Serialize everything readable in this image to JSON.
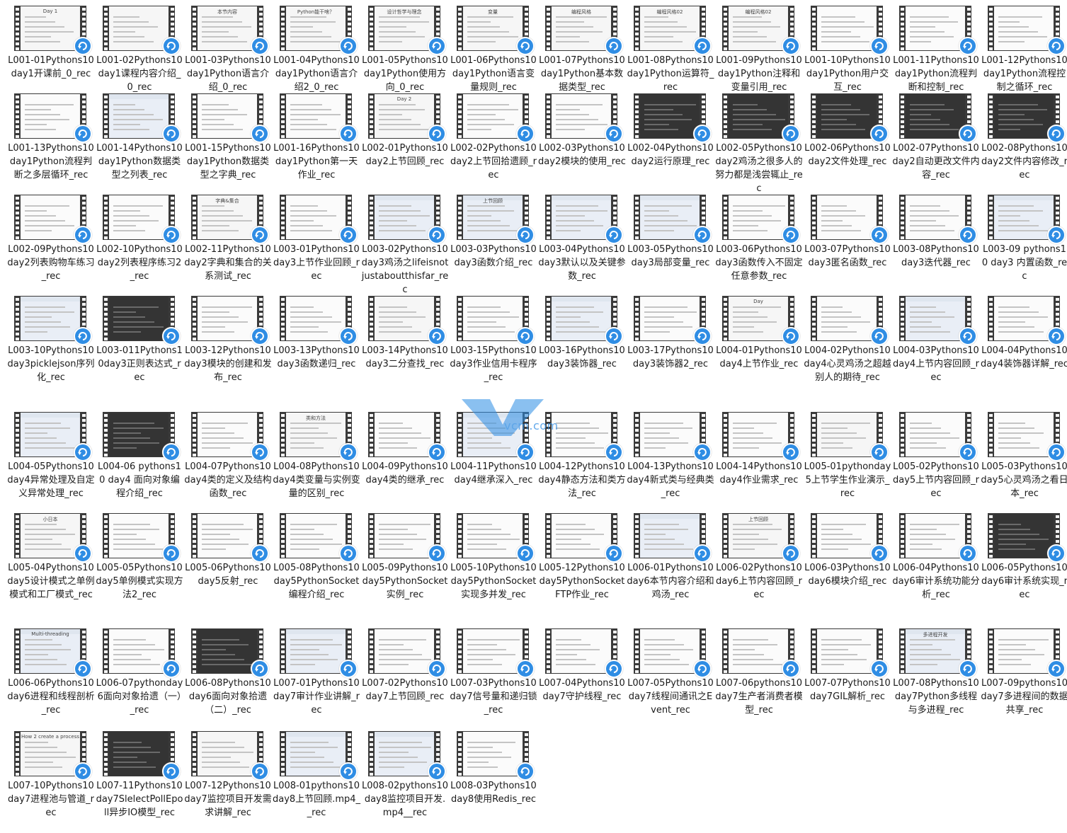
{
  "watermark": {
    "text": "vcm.com"
  },
  "colors": {
    "background": "#ffffff",
    "film": "#3a3a3a",
    "badge": "#2f8de4"
  },
  "files": [
    {
      "label": "L001-01Pythons10day1开课前_0_rec",
      "thumb_theme": "light",
      "thumb_title": "Day 1"
    },
    {
      "label": "L001-02Pythons10day1课程内容介绍_0_rec",
      "thumb_theme": "light"
    },
    {
      "label": "L001-03Pythons10day1Python语言介绍_0_rec",
      "thumb_theme": "light",
      "thumb_title": "本节内容"
    },
    {
      "label": "L001-04Pythons10day1Python语言介绍2_0_rec",
      "thumb_theme": "light",
      "thumb_title": "Python能干啥？"
    },
    {
      "label": "L001-05Pythons10day1Python使用方向_0_rec",
      "thumb_theme": "light",
      "thumb_title": "设计哲学与理念"
    },
    {
      "label": "L001-06Pythons10day1Python语言变量规则_rec",
      "thumb_theme": "light",
      "thumb_title": "变量"
    },
    {
      "label": "L001-07Pythons10day1Python基本数据类型_rec",
      "thumb_theme": "light",
      "thumb_title": "编程风格"
    },
    {
      "label": "L001-08Pythons10day1Python运算符_rec",
      "thumb_theme": "light",
      "thumb_title": "编程风格02"
    },
    {
      "label": "L001-09Pythons10day1Python注释和变量引用_rec",
      "thumb_theme": "light",
      "thumb_title": "编程风格02"
    },
    {
      "label": "L001-10Pythons10day1Python用户交互_rec",
      "thumb_theme": "code"
    },
    {
      "label": "L001-11Pythons10day1Python流程判断和控制_rec",
      "thumb_theme": "code"
    },
    {
      "label": "L001-12Pythons10day1Python流程控制之循环_rec",
      "thumb_theme": "code"
    },
    {
      "label": "L001-13Pythons10day1Python流程判断之多层循环_rec",
      "thumb_theme": "code"
    },
    {
      "label": "L001-14Pythons10day1Python数据类型之列表_rec",
      "thumb_theme": "slide"
    },
    {
      "label": "L001-15Pythons10day1Python数据类型之字典_rec",
      "thumb_theme": "code"
    },
    {
      "label": "L001-16Pythons10day1Python第一天作业_rec",
      "thumb_theme": "code"
    },
    {
      "label": "L002-01Pythons10day2上节回顾_rec",
      "thumb_theme": "light",
      "thumb_title": "Day 2"
    },
    {
      "label": "L002-02Pythons10day2上节回拾遗顾_rec",
      "thumb_theme": "code"
    },
    {
      "label": "L002-03Pythons10day2模块的使用_rec",
      "thumb_theme": "code"
    },
    {
      "label": "L002-04Pythons10day2运行原理_rec",
      "thumb_theme": "dark"
    },
    {
      "label": "L002-05Pythons10day2鸡汤之很多人的努力都是浅尝辄止_rec",
      "thumb_theme": "dark"
    },
    {
      "label": "L002-06Pythons10day2文件处理_rec",
      "thumb_theme": "dark"
    },
    {
      "label": "L002-07Pythons10day2自动更改文件内容_rec",
      "thumb_theme": "dark"
    },
    {
      "label": "L002-08Pythons10day2文件内容修改_rec",
      "thumb_theme": "dark"
    },
    {
      "label": "L002-09Pythons10day2列表购物车练习_rec",
      "thumb_theme": "code"
    },
    {
      "label": "L002-10Pythons10day2列表程序练习2_rec",
      "thumb_theme": "code"
    },
    {
      "label": "L002-11Pythons10day2字典和集合的关系测试_rec",
      "thumb_theme": "light",
      "thumb_title": "字典&集合"
    },
    {
      "label": "L003-01Pythons10day3上节作业回顾_rec",
      "thumb_theme": "code"
    },
    {
      "label": "L003-02Pythons10day3鸡汤之lifeisnotjustaboutthisfar_rec",
      "thumb_theme": "slide"
    },
    {
      "label": "L003-03Pythons10day3函数介绍_rec",
      "thumb_theme": "slide",
      "thumb_title": "上节回顾"
    },
    {
      "label": "L003-04Pythons10day3默认以及关键参数_rec",
      "thumb_theme": "slide"
    },
    {
      "label": "L003-05Pythons10day3局部变量_rec",
      "thumb_theme": "slide"
    },
    {
      "label": "L003-06Pythons10day3函数传入不固定任意参数_rec",
      "thumb_theme": "code"
    },
    {
      "label": "L003-07Pythons10day3匿名函数_rec",
      "thumb_theme": "code"
    },
    {
      "label": "L003-08Pythons10day3迭代器_rec",
      "thumb_theme": "code"
    },
    {
      "label": "L003-09 pythons10 day3 内置函数_rec",
      "thumb_theme": "slide"
    },
    {
      "label": "L003-10Pythons10day3picklejson序列化_rec",
      "thumb_theme": "slide"
    },
    {
      "label": "L003-011Pythons10day3正则表达式_rec",
      "thumb_theme": "dark"
    },
    {
      "label": "L003-12Pythons10day3模块的创建和发布_rec",
      "thumb_theme": "code"
    },
    {
      "label": "L003-13Pythons10day3函数递归_rec",
      "thumb_theme": "code"
    },
    {
      "label": "L003-14Pythons10day3二分查找_rec",
      "thumb_theme": "light"
    },
    {
      "label": "L003-15Pythons10day3作业信用卡程序_rec",
      "thumb_theme": "code"
    },
    {
      "label": "L003-16Pythons10day3装饰器_rec",
      "thumb_theme": "slide"
    },
    {
      "label": "L003-17Pythons10day3装饰器2_rec",
      "thumb_theme": "code"
    },
    {
      "label": "L004-01Pythons10day4上节作业_rec",
      "thumb_theme": "light",
      "thumb_title": "Day"
    },
    {
      "label": "L004-02Pythons10day4心灵鸡汤之超越别人的期待_rec",
      "thumb_theme": "code"
    },
    {
      "label": "L004-03Pythons10day4上节内容回顾_rec",
      "thumb_theme": "slide"
    },
    {
      "label": "L004-04Pythons10day4装饰器详解_rec",
      "thumb_theme": "code"
    },
    {
      "label": "L004-05Pythons10day4异常处理及自定义异常处理_rec",
      "thumb_theme": "slide"
    },
    {
      "label": "L004-06 pythons10 day4  面向对象编程介绍_rec",
      "thumb_theme": "dark"
    },
    {
      "label": "L004-07Pythons10day4类的定义及结构函数_rec",
      "thumb_theme": "code"
    },
    {
      "label": "L004-08Pythons10day4类变量与实例变量的区别_rec",
      "thumb_theme": "light",
      "thumb_title": "类和方法"
    },
    {
      "label": "L004-09Pythons10day4类的继承_rec",
      "thumb_theme": "code"
    },
    {
      "label": "L004-11Pythons10day4继承深入_rec",
      "thumb_theme": "slide"
    },
    {
      "label": "L004-12Pythons10day4静态方法和类方法_rec",
      "thumb_theme": "code"
    },
    {
      "label": "L004-13Pythons10day4新式类与经典类_rec",
      "thumb_theme": "code"
    },
    {
      "label": "L004-14Pythons10day4作业需求_rec",
      "thumb_theme": "code"
    },
    {
      "label": "L005-01pythonday5上节学生作业演示_rec",
      "thumb_theme": "light"
    },
    {
      "label": "L005-02Pythons10day5上节内容回顾_rec",
      "thumb_theme": "code"
    },
    {
      "label": "L005-03Pythons10day5心灵鸡汤之看日本_rec",
      "thumb_theme": "code"
    },
    {
      "label": "L005-04Pythons10day5设计模式之单例模式和工厂模式_rec",
      "thumb_theme": "light",
      "thumb_title": "小日本"
    },
    {
      "label": "L005-05Pythons10day5单例模式实现方法2_rec",
      "thumb_theme": "code"
    },
    {
      "label": "L005-06Pythons10day5反射_rec",
      "thumb_theme": "code"
    },
    {
      "label": "L005-08Pythons10day5PythonSocket编程介绍_rec",
      "thumb_theme": "code"
    },
    {
      "label": "L005-09Pythons10day5PythonSocket实例_rec",
      "thumb_theme": "code"
    },
    {
      "label": "L005-10Pythons10day5PythonSocket实现多并发_rec",
      "thumb_theme": "code"
    },
    {
      "label": "L005-12Pythons10day5PythonSocketFTP作业_rec",
      "thumb_theme": "code"
    },
    {
      "label": "L006-01Pythons10day6本节内容介绍和鸡汤_rec",
      "thumb_theme": "slide"
    },
    {
      "label": "L006-02Pythons10day6上节内容回顾_rec",
      "thumb_theme": "light",
      "thumb_title": "上节回顾"
    },
    {
      "label": "L006-03Pythons10day6模块介绍_rec",
      "thumb_theme": "code"
    },
    {
      "label": "L006-04Pythons10day6审计系统功能分析_rec",
      "thumb_theme": "code"
    },
    {
      "label": "L006-05Pythons10day6审计系统实现_rec",
      "thumb_theme": "dark"
    },
    {
      "label": "L006-06Pythons10day6进程和线程剖析_rec",
      "thumb_theme": "slide",
      "thumb_title": "Multi-threading"
    },
    {
      "label": "L006-07pythonday6面向对象拾遗（一）_rec",
      "thumb_theme": "code"
    },
    {
      "label": "L006-08Pythons10day6面向对象拾遗（二）_rec",
      "thumb_theme": "dark"
    },
    {
      "label": "L007-01Pythons10day7审计作业讲解_rec",
      "thumb_theme": "slide"
    },
    {
      "label": "L007-02Pythons10day7上节回顾_rec",
      "thumb_theme": "code"
    },
    {
      "label": "L007-03Pythons10day7信号量和递归锁_rec",
      "thumb_theme": "code"
    },
    {
      "label": "L007-04Pythons10day7守护线程_rec",
      "thumb_theme": "code"
    },
    {
      "label": "L007-05Pythons10day7线程间通讯之Event_rec",
      "thumb_theme": "code"
    },
    {
      "label": "L007-06pythons10day7生产者消费者模型_rec",
      "thumb_theme": "code"
    },
    {
      "label": "L007-07Pythons10day7GIL解析_rec",
      "thumb_theme": "code"
    },
    {
      "label": "L007-08Pythons10day7Python多线程与多进程_rec",
      "thumb_theme": "slide",
      "thumb_title": "多进程开发"
    },
    {
      "label": "L007-09pythons10day7多进程间的数据共享_rec",
      "thumb_theme": "code"
    },
    {
      "label": "L007-10Pythons10day7进程池与管道_rec",
      "thumb_theme": "light",
      "thumb_title": "How 2 create a process"
    },
    {
      "label": "L007-11Pythons10day7SlelectPollEpoll异步IO模型_rec",
      "thumb_theme": "dark"
    },
    {
      "label": "L007-12Pythons10day7监控项目开发需求讲解_rec",
      "thumb_theme": "light"
    },
    {
      "label": "L008-01pythons10day8上节回顾.mp4__rec",
      "thumb_theme": "slide"
    },
    {
      "label": "L008-02pythons10day8监控项目开发.mp4__rec",
      "thumb_theme": "slide"
    },
    {
      "label": "L008-03Pythons10day8使用Redis_rec",
      "thumb_theme": "code"
    }
  ]
}
